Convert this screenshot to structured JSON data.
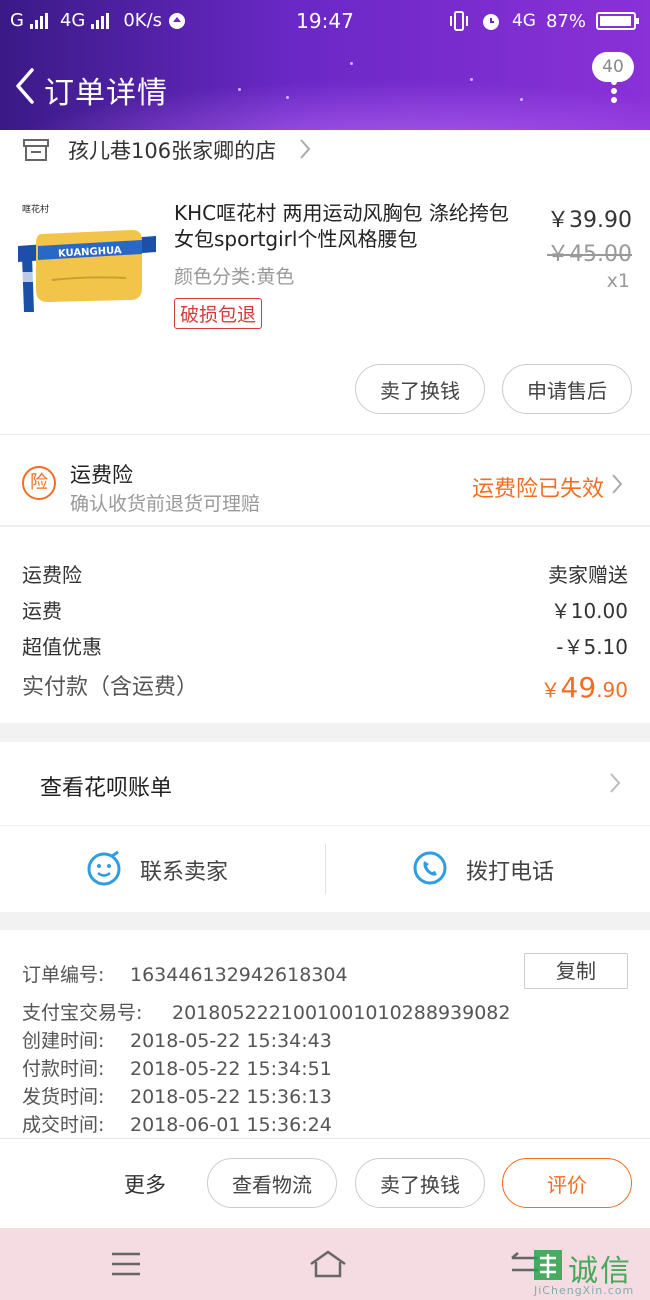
{
  "status_bar": {
    "carrier_1": "G",
    "carrier_2": "4G",
    "speed": "0K/s",
    "time": "19:47",
    "network_right": "4G",
    "battery": "87%",
    "battery_level": 0.87
  },
  "nav": {
    "title": "订单详情",
    "badge": "40"
  },
  "shop": {
    "name": "孩儿巷106张家卿的店"
  },
  "product": {
    "brand_label": "KUANGHUA",
    "title": "KHC哐花村 两用运动风胸包 涤纶挎包女包sportgirl个性风格腰包",
    "sku": "颜色分类:黄色",
    "tag": "破损包退",
    "price": "￥39.90",
    "original_price": "￥45.00",
    "quantity": "x1",
    "buttons": {
      "sell": "卖了换钱",
      "after_sale": "申请售后"
    }
  },
  "insurance": {
    "icon_text": "险",
    "title": "运费险",
    "subtitle": "确认收货前退货可理赔",
    "status": "运费险已失效"
  },
  "fees": [
    {
      "label": "运费险",
      "value": "卖家赠送"
    },
    {
      "label": "运费",
      "value": "￥10.00"
    },
    {
      "label": "超值优惠",
      "value": "-￥5.10"
    }
  ],
  "total": {
    "label": "实付款（含运费）",
    "currency": "￥",
    "integer": "49",
    "decimal": ".90"
  },
  "huabei": {
    "label": "查看花呗账单"
  },
  "contact": {
    "seller": "联系卖家",
    "phone": "拨打电话"
  },
  "order_info": {
    "copy_button": "复制",
    "rows": [
      {
        "key": "订单编号:",
        "value": "163446132942618304"
      },
      {
        "key": "支付宝交易号:",
        "value": "2018052221001001010288939082"
      },
      {
        "key": "创建时间:",
        "value": "2018-05-22 15:34:43"
      },
      {
        "key": "付款时间:",
        "value": "2018-05-22 15:34:51"
      },
      {
        "key": "发货时间:",
        "value": "2018-05-22 15:36:13"
      },
      {
        "key": "成交时间:",
        "value": "2018-06-01 15:36:24"
      }
    ]
  },
  "actions": {
    "more": "更多",
    "logistics": "查看物流",
    "sell": "卖了换钱",
    "review": "评价"
  },
  "watermark": {
    "text": "诚信",
    "url": "JiChengXin.com"
  },
  "colors": {
    "accent": "#f36d22",
    "header_start": "#3a1a86",
    "header_end": "#8a31d8",
    "tag_red": "#d73a3a",
    "icon_blue": "#2f9ee0"
  }
}
